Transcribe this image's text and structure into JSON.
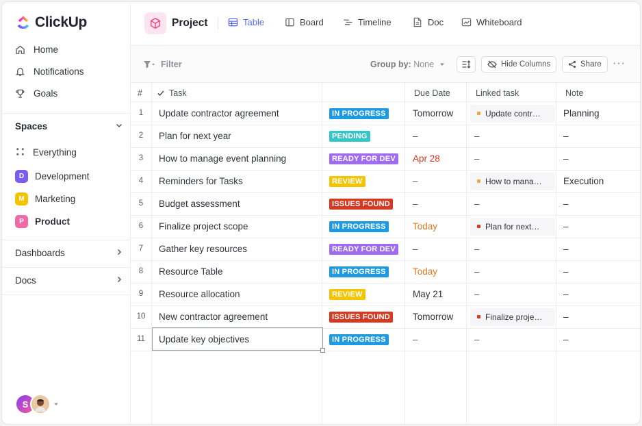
{
  "brand": {
    "name": "ClickUp"
  },
  "sidebar": {
    "nav": [
      {
        "label": "Home",
        "icon": "home-icon"
      },
      {
        "label": "Notifications",
        "icon": "bell-icon"
      },
      {
        "label": "Goals",
        "icon": "trophy-icon"
      }
    ],
    "spaces_label": "Spaces",
    "everything_label": "Everything",
    "spaces": [
      {
        "letter": "D",
        "label": "Development",
        "color": "#7b5cf0"
      },
      {
        "letter": "M",
        "label": "Marketing",
        "color": "#f5c400"
      },
      {
        "letter": "P",
        "label": "Product",
        "color": "#f06aa8"
      }
    ],
    "dashboards_label": "Dashboards",
    "docs_label": "Docs",
    "avatar_letter": "S"
  },
  "header": {
    "title": "Project",
    "views": [
      "Table",
      "Board",
      "Timeline",
      "Doc",
      "Whiteboard"
    ]
  },
  "toolbar": {
    "filter_label": "Filter",
    "group_by_label": "Group by:",
    "group_by_value": "None",
    "hide_columns_label": "Hide Columns",
    "share_label": "Share",
    "more_label": "···"
  },
  "table": {
    "columns": [
      "#",
      "Task",
      "",
      "Due Date",
      "Linked task",
      "Note"
    ],
    "status_colors": {
      "IN PROGRESS": "#1e9be0",
      "PENDING": "#36c5c9",
      "READY FOR DEV": "#9f6cf0",
      "REVIEW": "#f5c400",
      "ISSUES FOUND": "#d63a20"
    },
    "rows": [
      {
        "num": "1",
        "task": "Update contractor agreement",
        "status": "IN PROGRESS",
        "due": "Tomorrow",
        "due_color": "#2f333a",
        "linked": "Update contr…",
        "linked_color": "#f0a94a",
        "note": "Planning"
      },
      {
        "num": "2",
        "task": "Plan for next year",
        "status": "PENDING",
        "due": "–",
        "due_color": "#555",
        "linked": "",
        "linked_color": "",
        "note": "–"
      },
      {
        "num": "3",
        "task": "How to manage event planning",
        "status": "READY FOR DEV",
        "due": "Apr 28",
        "due_color": "#d63a20",
        "linked": "",
        "linked_color": "",
        "note": "–"
      },
      {
        "num": "4",
        "task": "Reminders for Tasks",
        "status": "REVIEW",
        "due": "–",
        "due_color": "#555",
        "linked": "How to mana…",
        "linked_color": "#f0a94a",
        "note": "Execution"
      },
      {
        "num": "5",
        "task": "Budget assessment",
        "status": "ISSUES FOUND",
        "due": "–",
        "due_color": "#555",
        "linked": "",
        "linked_color": "",
        "note": "–"
      },
      {
        "num": "6",
        "task": "Finalize project scope",
        "status": "IN PROGRESS",
        "due": "Today",
        "due_color": "#e07a22",
        "linked": "Plan for next…",
        "linked_color": "#d63a20",
        "note": "–"
      },
      {
        "num": "7",
        "task": "Gather key resources",
        "status": "READY FOR DEV",
        "due": "–",
        "due_color": "#555",
        "linked": "",
        "linked_color": "",
        "note": "–"
      },
      {
        "num": "8",
        "task": "Resource Table",
        "status": "IN PROGRESS",
        "due": "Today",
        "due_color": "#e07a22",
        "linked": "",
        "linked_color": "",
        "note": "–"
      },
      {
        "num": "9",
        "task": "Resource allocation",
        "status": "REVIEW",
        "due": "May 21",
        "due_color": "#2f333a",
        "linked": "",
        "linked_color": "",
        "note": "–"
      },
      {
        "num": "10",
        "task": "New contractor agreement",
        "status": "ISSUES FOUND",
        "due": "Tomorrow",
        "due_color": "#2f333a",
        "linked": "Finalize proje…",
        "linked_color": "#d63a20",
        "note": "–"
      },
      {
        "num": "11",
        "task": "Update key objectives",
        "status": "IN PROGRESS",
        "due": "–",
        "due_color": "#555",
        "linked": "",
        "linked_color": "",
        "note": "–"
      }
    ]
  }
}
